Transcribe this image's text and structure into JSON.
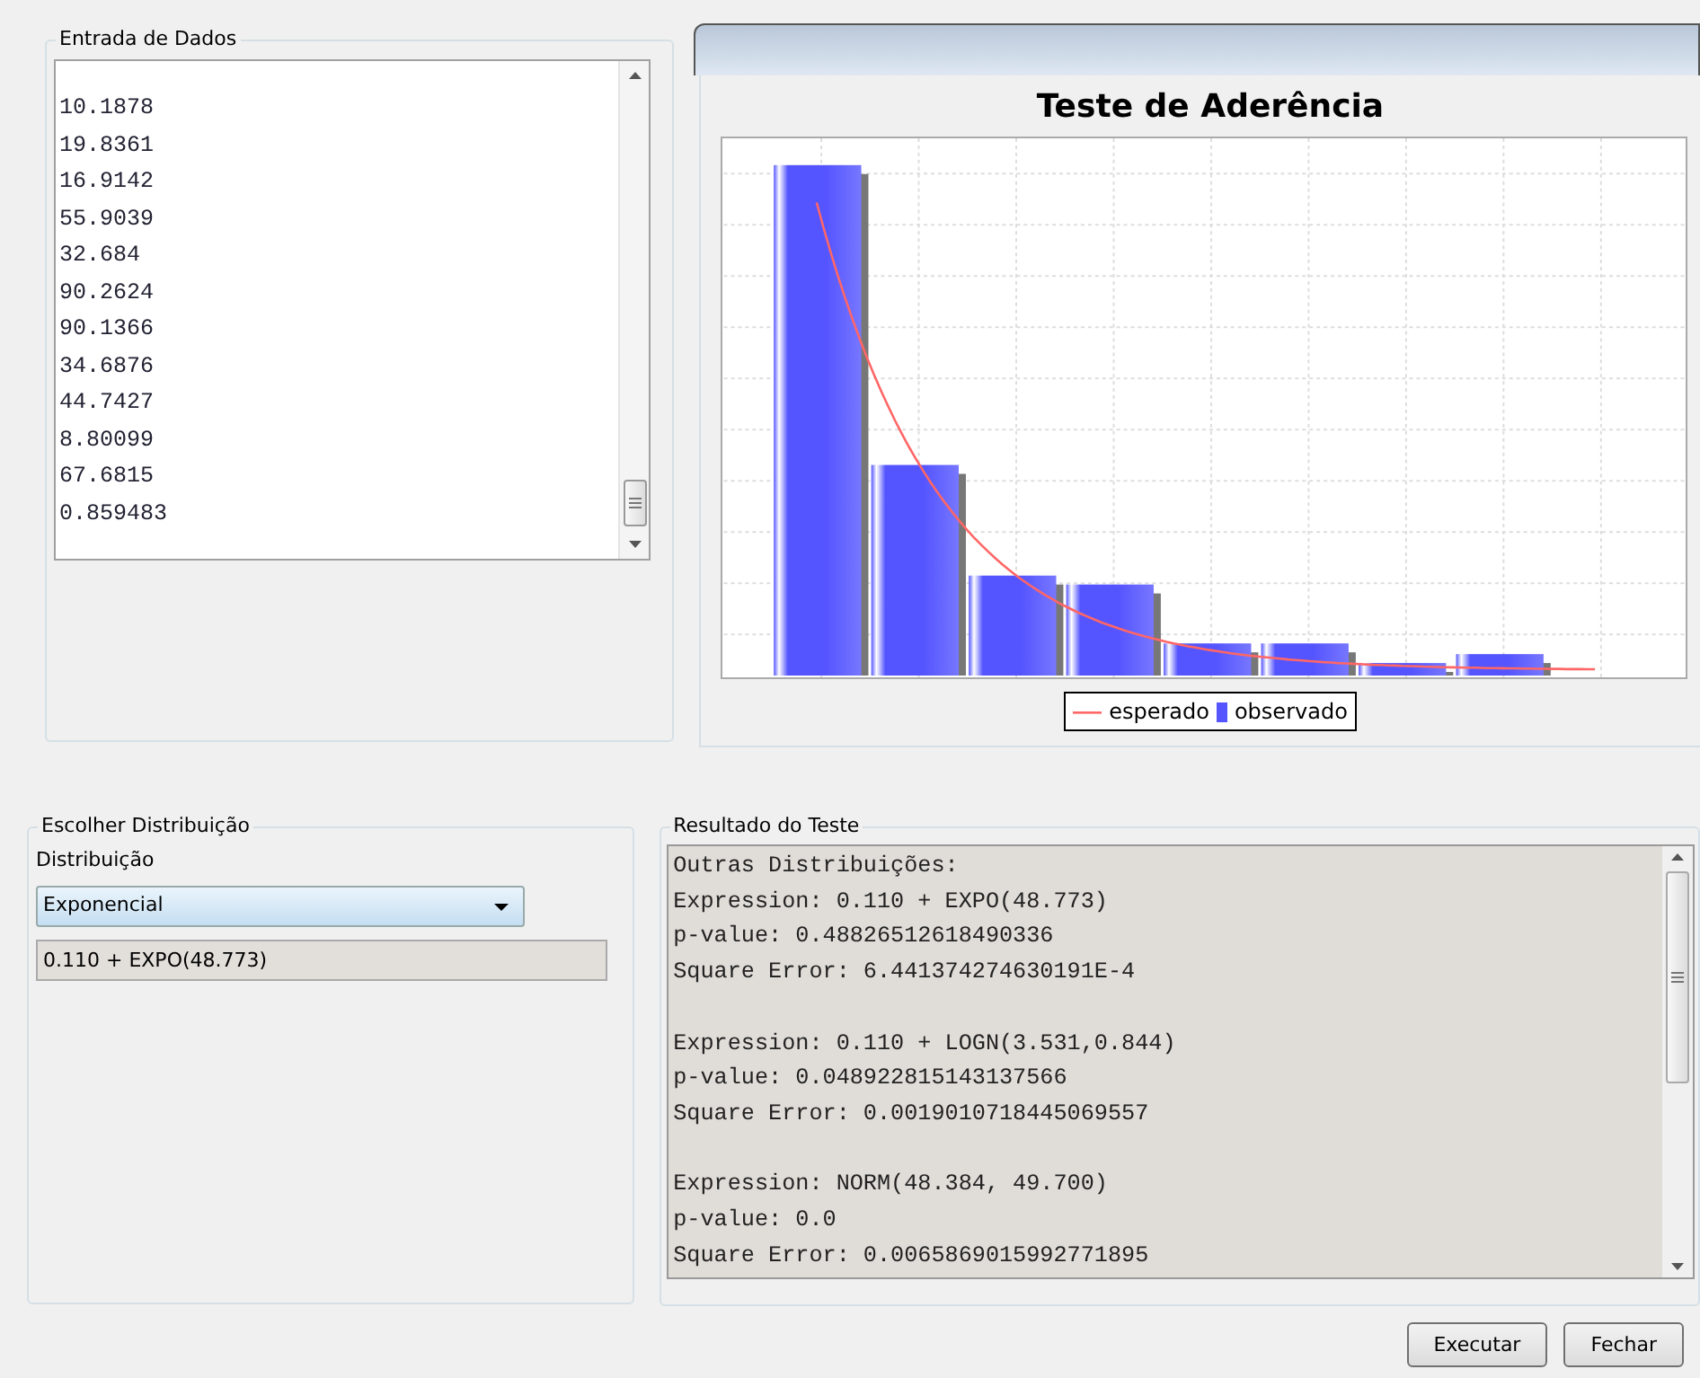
{
  "data_input": {
    "title": "Entrada de Dados",
    "values": [
      "10.1878",
      "19.8361",
      "16.9142",
      "55.9039",
      "32.684",
      "90.2624",
      "90.1366",
      "34.6876",
      "44.7427",
      "8.80099",
      "67.6815",
      "0.859483"
    ]
  },
  "chart": {
    "title": "Teste de Aderência",
    "legend": [
      {
        "label": "esperado",
        "kind": "line",
        "color": "#ff6666"
      },
      {
        "label": "observado",
        "kind": "bar",
        "color": "#5555ff"
      }
    ]
  },
  "distribution": {
    "title": "Escolher Distribuição",
    "label": "Distribuição",
    "selected_option": "Exponencial",
    "expression": "0.110 + EXPO(48.773)"
  },
  "result": {
    "title": "Resultado do Teste",
    "blocks": [
      [
        "Outras Distribuições:",
        "Expression: 0.110 + EXPO(48.773)",
        "p-value: 0.48826512618490336",
        "Square Error: 6.441374274630191E-4"
      ],
      [
        "Expression: 0.110 + LOGN(3.531,0.844)",
        "p-value: 0.048922815143137566",
        "Square Error: 0.0019010718445069557"
      ],
      [
        "Expression: NORM(48.384, 49.700)",
        "p-value: 0.0",
        "Square Error: 0.0065869015992771895"
      ]
    ]
  },
  "buttons": [
    "Executar",
    "Fechar"
  ]
}
